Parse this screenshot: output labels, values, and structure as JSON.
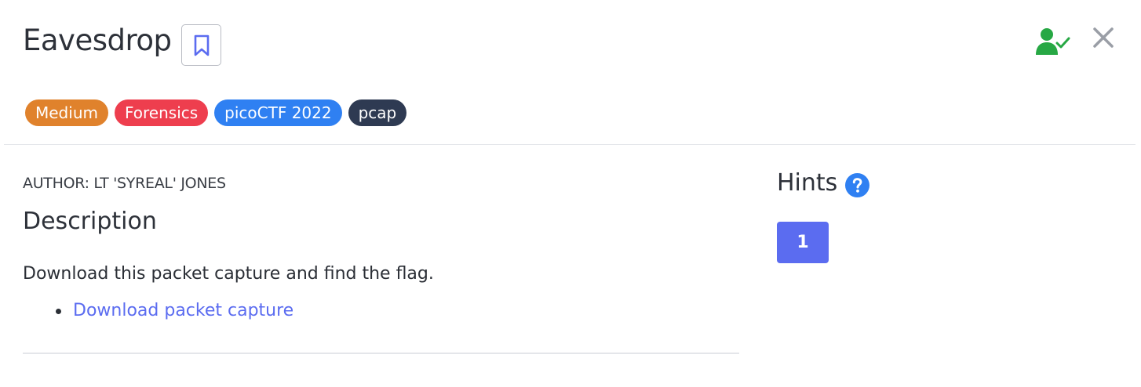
{
  "challenge": {
    "title": "Eavesdrop",
    "tags": [
      {
        "label": "Medium",
        "color": "#e0822c"
      },
      {
        "label": "Forensics",
        "color": "#ee3e4e"
      },
      {
        "label": "picoCTF 2022",
        "color": "#2f80f2"
      },
      {
        "label": "pcap",
        "color": "#2e3a52"
      }
    ]
  },
  "header_icons": {
    "bookmark": "bookmark-icon",
    "solved": "user-check-icon",
    "close": "close-icon"
  },
  "colors": {
    "accent": "#5b6cf0",
    "solved_green": "#27a844",
    "help_blue": "#2f80f2"
  },
  "description": {
    "author": "AUTHOR: LT 'SYREAL' JONES",
    "heading": "Description",
    "text": "Download this packet capture and find the flag.",
    "links": [
      "Download packet capture"
    ]
  },
  "hints": {
    "heading": "Hints",
    "help_icon": "question-circle-icon",
    "buttons": [
      "1"
    ]
  }
}
